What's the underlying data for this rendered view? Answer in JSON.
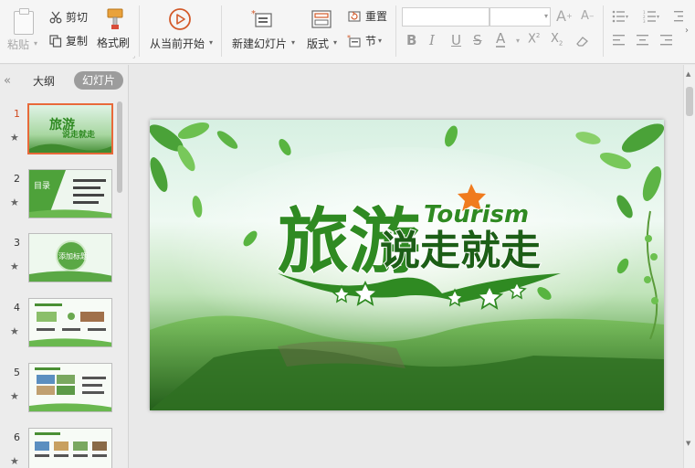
{
  "toolbar": {
    "paste": "粘贴",
    "cut": "剪切",
    "copy": "复制",
    "format_painter": "格式刷",
    "from_current": "从当前开始",
    "new_slide": "新建幻灯片",
    "layout": "版式",
    "reset": "重置",
    "section": "节"
  },
  "left_panel": {
    "tab_outline": "大纲",
    "tab_slides": "幻灯片",
    "slides": [
      {
        "number": "1",
        "active": true
      },
      {
        "number": "2",
        "active": false
      },
      {
        "number": "3",
        "active": false
      },
      {
        "number": "4",
        "active": false
      },
      {
        "number": "5",
        "active": false
      },
      {
        "number": "6",
        "active": false
      }
    ]
  },
  "slide_content": {
    "title_line1": "旅游",
    "title_line2": "说走就走",
    "title_en": "Tourism",
    "thumb2_heading": "目录",
    "thumb3_heading": "添加标题"
  },
  "colors": {
    "accent_orange": "#e8693a",
    "title_green": "#2f8a22",
    "title_dark": "#1c5e16",
    "star_orange": "#f07b1e"
  }
}
